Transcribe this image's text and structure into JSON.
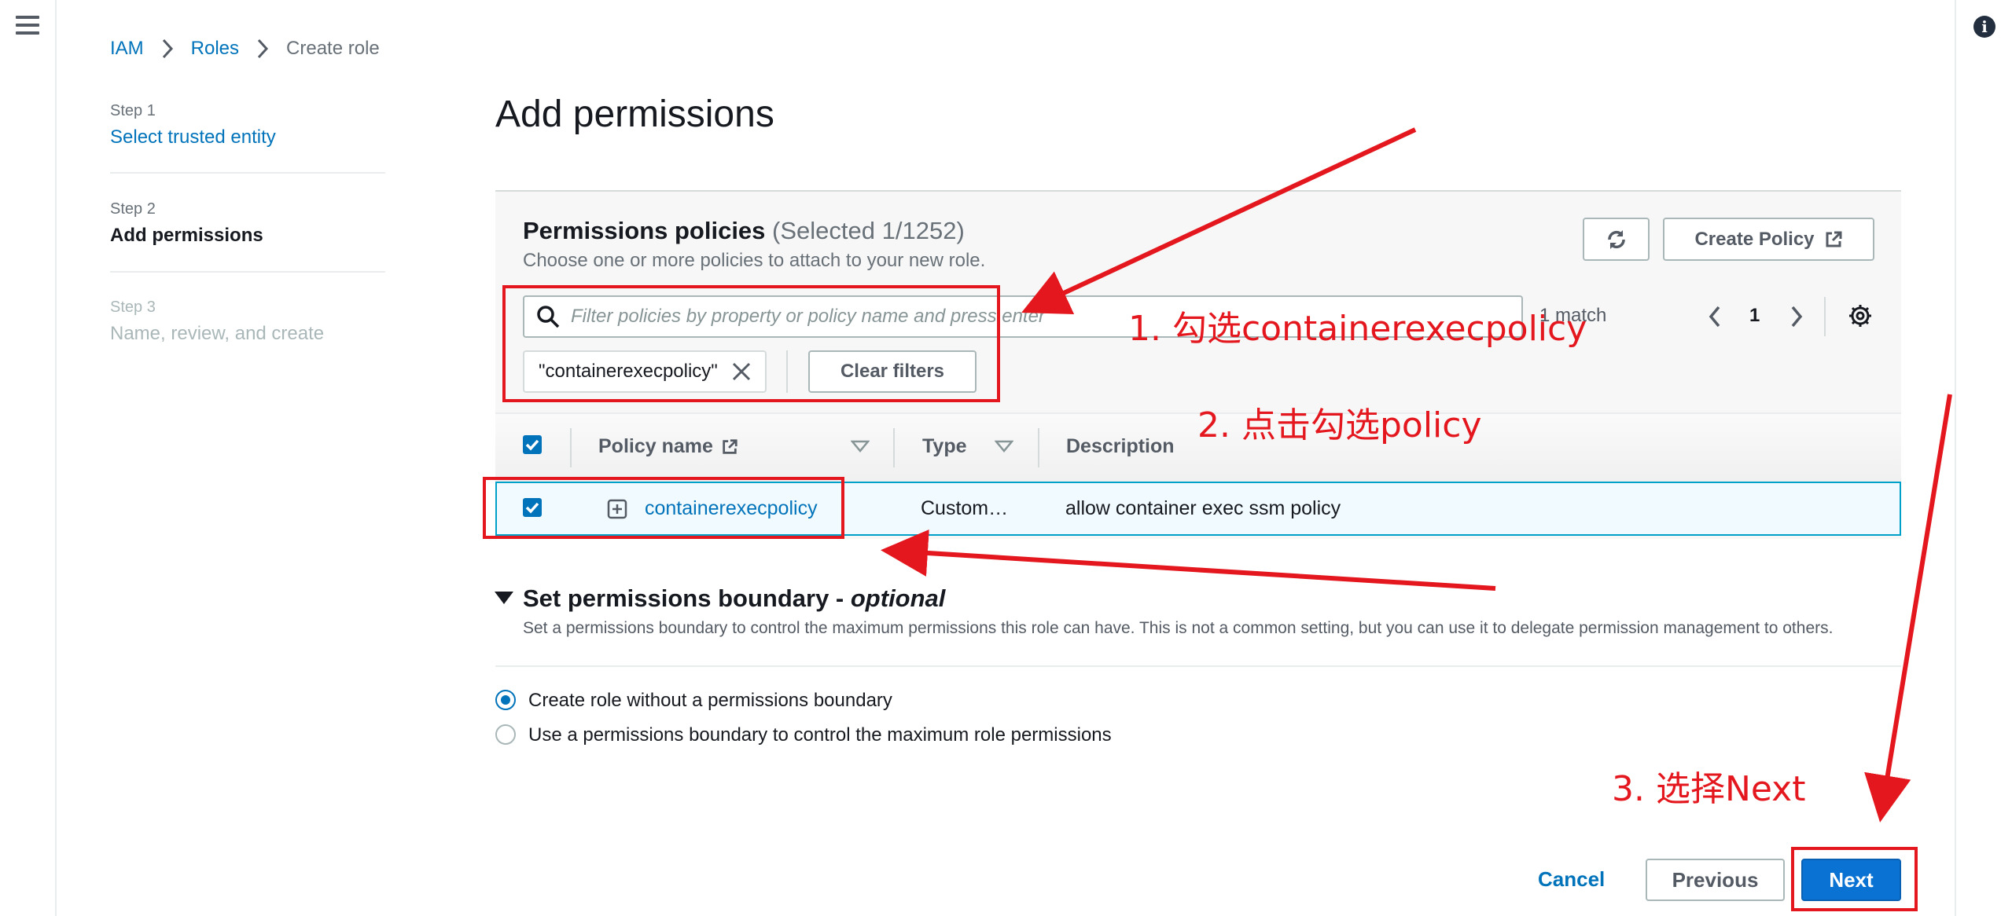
{
  "breadcrumb": {
    "items": [
      "IAM",
      "Roles"
    ],
    "current": "Create role"
  },
  "steps": [
    {
      "num": "Step 1",
      "label": "Select trusted entity"
    },
    {
      "num": "Step 2",
      "label": "Add permissions"
    },
    {
      "num": "Step 3",
      "label": "Name, review, and create"
    }
  ],
  "page": {
    "title": "Add permissions"
  },
  "policies": {
    "title": "Permissions policies",
    "selected": "(Selected 1/1252)",
    "subtitle": "Choose one or more policies to attach to your new role.",
    "create_label": "Create Policy",
    "search_placeholder": "Filter policies by property or policy name and press enter",
    "match_count": "1 match",
    "page_number": "1",
    "filter_token": "\"containerexecpolicy\"",
    "clear_label": "Clear filters",
    "columns": [
      "Policy name",
      "Type",
      "Description"
    ],
    "rows": [
      {
        "name": "containerexecpolicy",
        "type": "Custom…",
        "description": "allow container exec ssm policy",
        "checked": true
      }
    ]
  },
  "boundary": {
    "title": "Set permissions boundary - ",
    "title_optional": "optional",
    "description": "Set a permissions boundary to control the maximum permissions this role can have. This is not a common setting, but you can use it to delegate permission management to others.",
    "options": [
      "Create role without a permissions boundary",
      "Use a permissions boundary to control the maximum role permissions"
    ],
    "selected_index": 0
  },
  "footer": {
    "cancel": "Cancel",
    "previous": "Previous",
    "next": "Next"
  },
  "annotations": [
    "1. 勾选containerexecpolicy",
    "2. 点击勾选policy",
    "3. 选择Next"
  ],
  "colors": {
    "link": "#0073bb",
    "primary": "#0972d3",
    "annotation": "#e3171d",
    "selected_row": "#f1faff"
  }
}
